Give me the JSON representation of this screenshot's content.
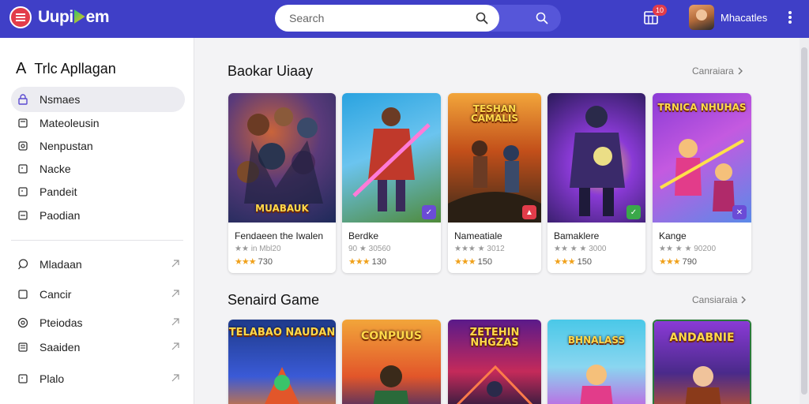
{
  "app": {
    "brand": "Uupi",
    "brand_tail": "em"
  },
  "search": {
    "placeholder": "Search"
  },
  "header": {
    "cart_count": "10",
    "user_name": "Mhacatles"
  },
  "sidebar": {
    "title": "Trlc Apllagan",
    "primary": [
      {
        "label": "Nsmaes",
        "icon": "lock-icon",
        "active": true
      },
      {
        "label": "Mateoleusin",
        "icon": "card-icon"
      },
      {
        "label": "Nenpustan",
        "icon": "gear-icon"
      },
      {
        "label": "Nacke",
        "icon": "square-icon"
      },
      {
        "label": "Pandeit",
        "icon": "square-icon"
      },
      {
        "label": "Paodian",
        "icon": "square-icon"
      }
    ],
    "secondary": [
      {
        "label": "Mladaan",
        "icon": "chat-icon"
      },
      {
        "label": "Cancir",
        "icon": "square-icon"
      },
      {
        "label": "Pteiodas",
        "icon": "gear-icon"
      },
      {
        "label": "Saaiden",
        "icon": "list-icon"
      },
      {
        "label": "Plalo",
        "icon": "square-icon"
      }
    ]
  },
  "sections": [
    {
      "title": "Baokar Uiaay",
      "see_all": "Canraiara",
      "cards": [
        {
          "title": "Fendaeen the Iwalen",
          "meta": "★★ in Mbl20",
          "rating": "730",
          "art_text": "MUABAUK",
          "corner": ""
        },
        {
          "title": "Berdke",
          "meta": "90 ★ 30560",
          "rating": "130",
          "art_text": "",
          "corner": "✓"
        },
        {
          "title": "Nameatiale",
          "meta": "★★★ ★ 3012",
          "rating": "150",
          "art_text": "TESHAN CAMALIS",
          "corner": "▲"
        },
        {
          "title": "Bamaklere",
          "meta": "★★ ★ ★ 3000",
          "rating": "150",
          "art_text": "",
          "corner": "✓"
        },
        {
          "title": "Kange",
          "meta": "★★ ★ ★ 90200",
          "rating": "790",
          "art_text": "TRNICA NHUHAS",
          "corner": "✕"
        }
      ]
    },
    {
      "title": "Senaird Game",
      "see_all": "Cansiaraia",
      "cards": [
        {
          "art_text": "TELABAO NAUDAN"
        },
        {
          "art_text": "CONPUUS"
        },
        {
          "art_text": "ZETEHIN NHGZAS"
        },
        {
          "art_text": "BHNALASS"
        },
        {
          "art_text": "ANDABNIE"
        }
      ]
    }
  ],
  "colors": {
    "topbar": "#3f3fc7",
    "accent_red": "#e23c4a",
    "star": "#f0a11b"
  }
}
